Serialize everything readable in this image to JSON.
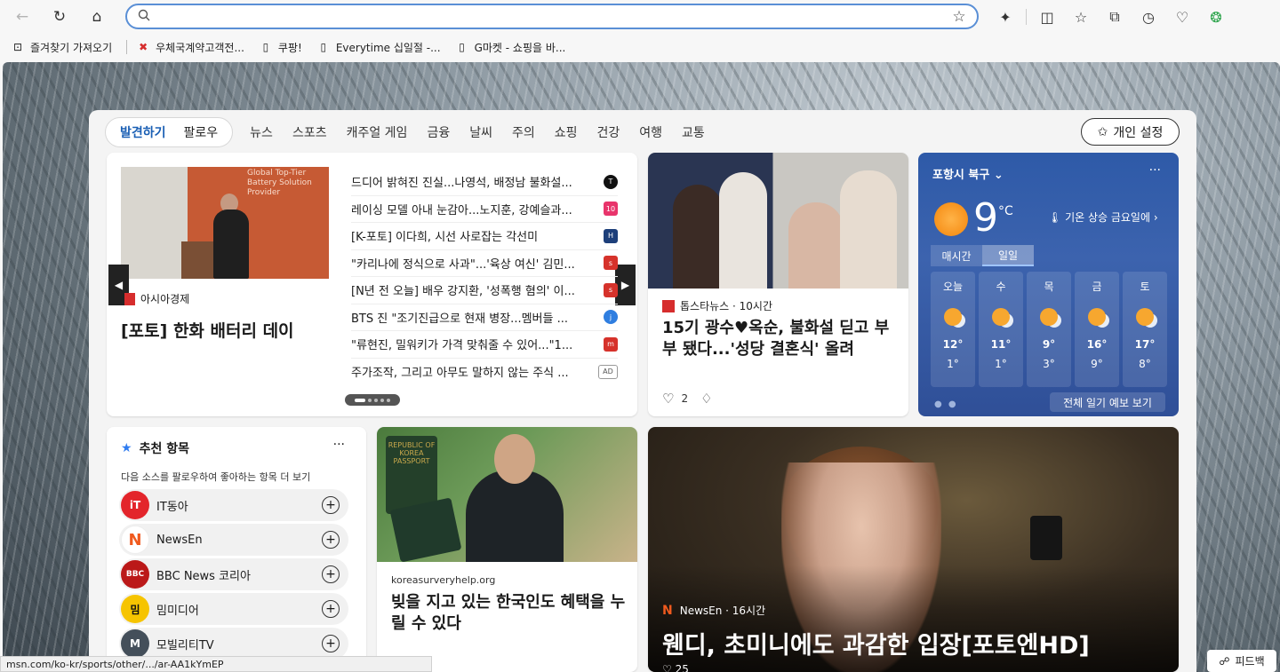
{
  "browser": {
    "address_value": "",
    "bookmarks": [
      {
        "label": "즐겨찾기 가져오기",
        "icon": "import-icon"
      },
      {
        "label": "우체국계약고객전...",
        "icon": "post-logo-icon"
      },
      {
        "label": "쿠팡!",
        "icon": "page-icon"
      },
      {
        "label": "Everytime 십일절 -...",
        "icon": "page-icon"
      },
      {
        "label": "G마켓 - 쇼핑을 바...",
        "icon": "page-icon"
      }
    ],
    "status_url": "msn.com/ko-kr/sports/other/.../ar-AA1kYmEP"
  },
  "feed": {
    "tabs_pill": [
      "발견하기",
      "팔로우"
    ],
    "tabs": [
      "뉴스",
      "스포츠",
      "캐주얼 게임",
      "금융",
      "날씨",
      "주의",
      "쇼핑",
      "건강",
      "여행",
      "교통"
    ],
    "personal_label": "개인 설정"
  },
  "hero": {
    "source": "아시아경제",
    "title": "[포토] 한화 배터리 데이",
    "banner_text": "Global Top-Tier Battery Solution Provider",
    "headlines": [
      {
        "text": "드디어 밝혀진 진실...나영석, 배정남 불화설...",
        "logo": "T",
        "color": "#111111"
      },
      {
        "text": "레이싱 모델 아내 눈감아...노지훈, 강예슬과...",
        "logo": "10",
        "color": "#e8346b"
      },
      {
        "text": "[K-포토] 이다희, 시선 사로잡는 각선미",
        "logo": "H",
        "color": "#1d3f7a"
      },
      {
        "text": "\"카리나에 정식으로 사과\"...'육상 여신' 김민...",
        "logo": "s",
        "color": "#d6322b"
      },
      {
        "text": "[N년 전 오늘] 배우 강지환, '성폭행 혐의' 이...",
        "logo": "s",
        "color": "#d6322b"
      },
      {
        "text": "BTS 진 \"조기진급으로 현재 병장...멤버들 ...",
        "logo": "j",
        "color": "#2f7ee0"
      },
      {
        "text": "\"류현진, 밀워키가 가격 맞춰줄 수 있어...\"1...",
        "logo": "m",
        "color": "#d6322b"
      },
      {
        "text": "주가조작, 그리고 아무도 말하지 않는 주식 ...",
        "logo": "AD",
        "color": "#ffffff"
      }
    ]
  },
  "couple_card": {
    "source": "톱스타뉴스 · 10시간",
    "title": "15기 광수♥옥순, 불화설 딛고 부부 됐다...'성당 결혼식' 올려",
    "likes": "2"
  },
  "weather": {
    "location": "포항시 북구",
    "temp": "9",
    "unit": "°C",
    "alert": "기온 상승 금요일에",
    "tab_hourly": "매시간",
    "tab_daily": "일일",
    "days": [
      {
        "name": "오늘",
        "hi": "12°",
        "lo": "1°"
      },
      {
        "name": "수",
        "hi": "11°",
        "lo": "1°"
      },
      {
        "name": "목",
        "hi": "9°",
        "lo": "3°"
      },
      {
        "name": "금",
        "hi": "16°",
        "lo": "9°"
      },
      {
        "name": "토",
        "hi": "17°",
        "lo": "8°"
      }
    ],
    "forecast_label": "전체 일기 예보 보기"
  },
  "recommend": {
    "title": "추천 항목",
    "subtitle": "다음 소스를 팔로우하여 좋아하는 항목 더 보기",
    "sources": [
      {
        "name": "IT동아",
        "logo": "iT",
        "color": "#e3252b"
      },
      {
        "name": "NewsEn",
        "logo": "N",
        "color": "#ffffff"
      },
      {
        "name": "BBC News 코리아",
        "logo": "BBC",
        "color": "#bb1919"
      },
      {
        "name": "밈미디어",
        "logo": "밈",
        "color": "#f6c400"
      },
      {
        "name": "모빌리티TV",
        "logo": "M",
        "color": "#444f5a"
      }
    ]
  },
  "sponsor": {
    "domain": "koreasurveryhelp.org",
    "title": "빚을 지고 있는 한국인도 혜택을 누릴 수 있다",
    "passport_text": "REPUBLIC OF KOREA PASSPORT"
  },
  "big_card": {
    "source": "NewsEn · 16시간",
    "title": "웬디, 초미니에도 과감한 입장[포토엔HD]",
    "likes": "25"
  },
  "feedback_label": "피드백"
}
